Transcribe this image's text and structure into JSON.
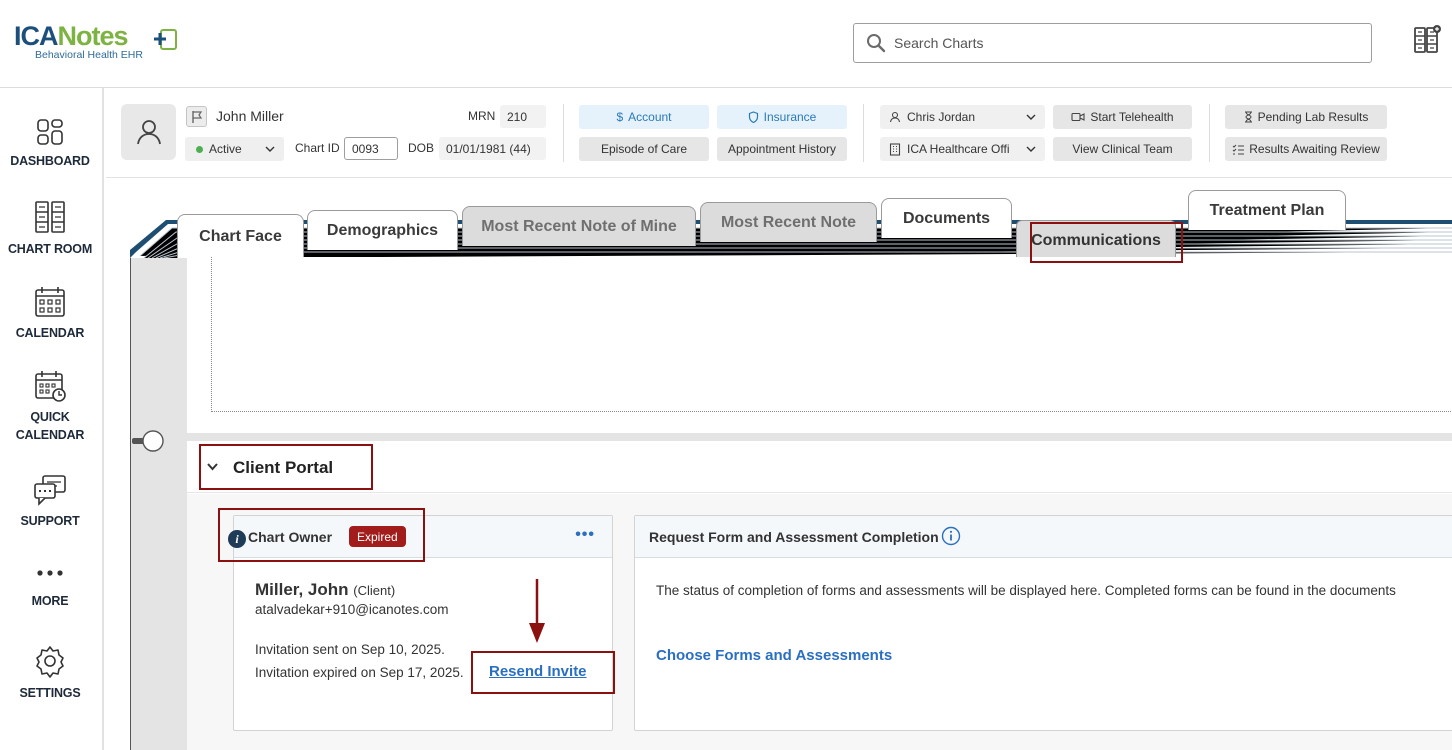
{
  "app": {
    "logo_text_1": "ICA",
    "logo_text_2": "Notes",
    "logo_tagline": "Behavioral Health EHR"
  },
  "search": {
    "placeholder": "Search Charts"
  },
  "sidebar": {
    "items": [
      {
        "label": "DASHBOARD",
        "icon": "dashboard-icon"
      },
      {
        "label": "CHART ROOM",
        "icon": "chart-room-icon"
      },
      {
        "label": "CALENDAR",
        "icon": "calendar-icon"
      },
      {
        "label_line1": "QUICK",
        "label_line2": "CALENDAR",
        "icon": "quick-calendar-icon"
      },
      {
        "label": "SUPPORT",
        "icon": "support-icon"
      },
      {
        "label": "MORE",
        "icon": "more-icon"
      },
      {
        "label": "SETTINGS",
        "icon": "settings-icon"
      }
    ]
  },
  "patient": {
    "name": "John Miller",
    "status": "Active",
    "chart_id_label": "Chart ID",
    "chart_id": "0093",
    "mrn_label": "MRN",
    "mrn": "210",
    "dob_label": "DOB",
    "dob": "01/01/1981 (44)"
  },
  "header_buttons": {
    "account": "Account",
    "insurance": "Insurance",
    "episode_of_care": "Episode of Care",
    "appointment_history": "Appointment History",
    "clinician": "Chris Jordan",
    "facility": "ICA Healthcare Offi",
    "start_telehealth": "Start Telehealth",
    "view_clinical_team": "View Clinical Team",
    "pending_lab_results": "Pending Lab Results",
    "results_awaiting_review": "Results Awaiting Review"
  },
  "tabs": [
    {
      "label": "Chart Face",
      "state": "normal"
    },
    {
      "label": "Demographics",
      "state": "normal"
    },
    {
      "label": "Most Recent Note of Mine",
      "state": "disabled"
    },
    {
      "label": "Most Recent Note",
      "state": "disabled"
    },
    {
      "label": "Documents",
      "state": "normal"
    },
    {
      "label": "Communications",
      "state": "active"
    },
    {
      "label": "Treatment Plan",
      "state": "normal"
    }
  ],
  "client_portal": {
    "title": "Client Portal",
    "owner_card": {
      "title": "Chart Owner",
      "badge": "Expired",
      "more": "•••",
      "name": "Miller, John",
      "role": "(Client)",
      "email": "atalvadekar+910@icanotes.com",
      "invitation_sent": "Invitation sent on Sep 10, 2025.",
      "invitation_expired": "Invitation expired on Sep 17, 2025.",
      "resend_link": "Resend Invite"
    },
    "forms_card": {
      "title": "Request Form and Assessment Completion",
      "description": "The status of completion of forms and assessments will be displayed here. Completed forms can be found in the documents",
      "link": "Choose Forms and Assessments"
    }
  },
  "colors": {
    "brand_blue": "#1d4f7c",
    "brand_green": "#7cb342",
    "link_blue": "#2a6fc0",
    "annotation_red": "#8b1111",
    "expired_badge": "#a31c1c"
  }
}
